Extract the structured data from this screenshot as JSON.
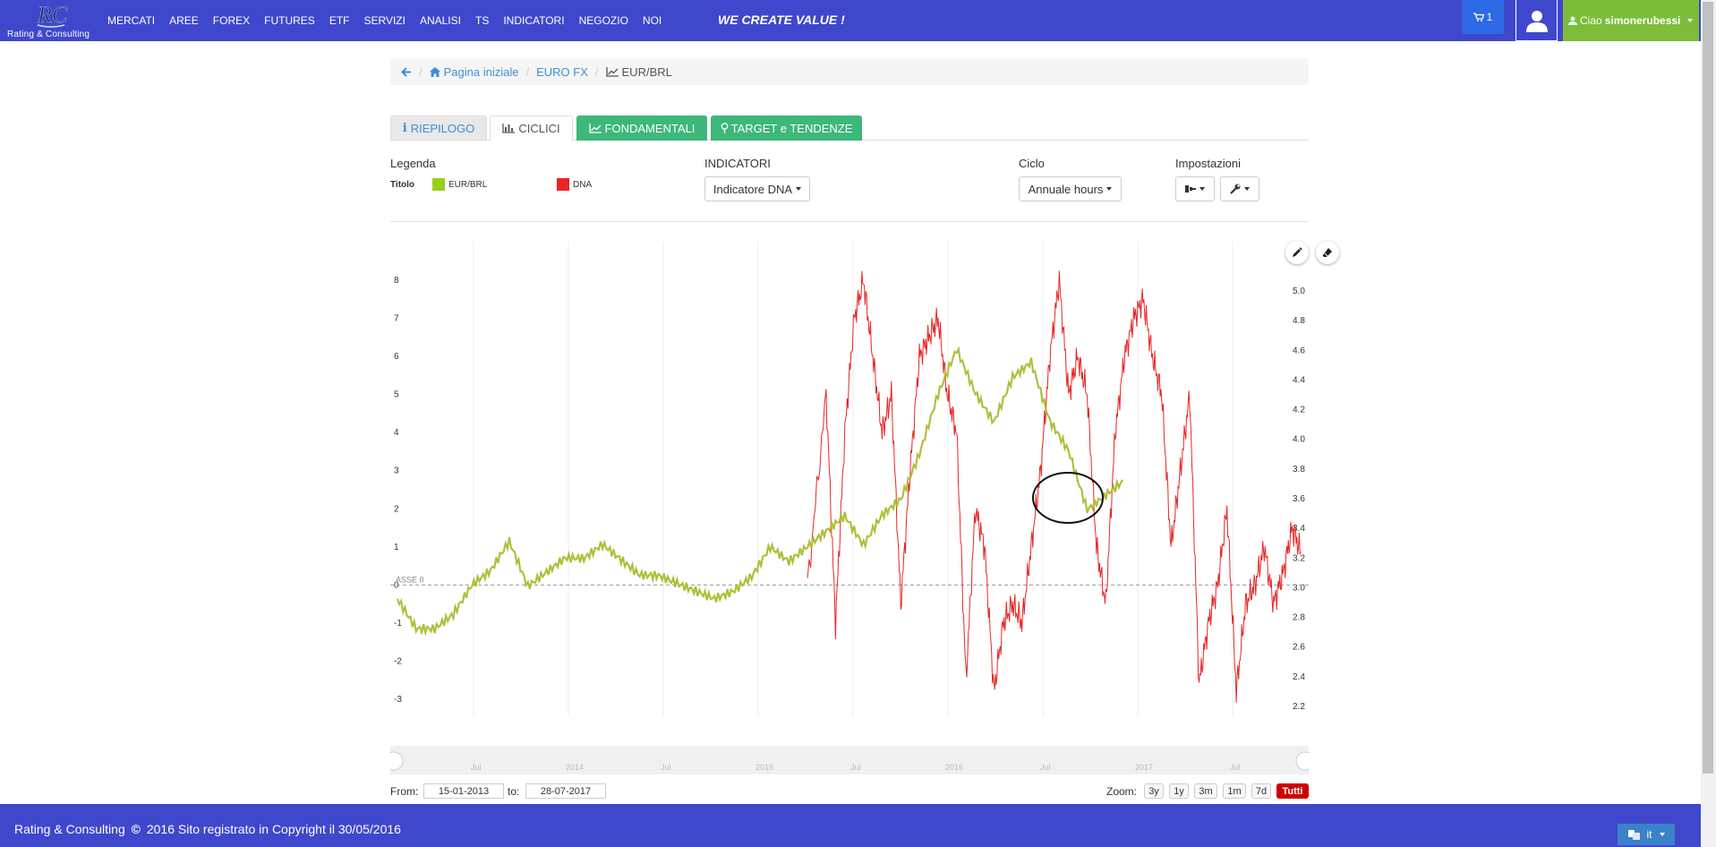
{
  "header": {
    "logo_text": "Rating & Consulting",
    "nav": [
      "MERCATI",
      "AREE",
      "FOREX",
      "FUTURES",
      "ETF",
      "SERVIZI",
      "ANALISI",
      "TS",
      "INDICATORI",
      "NEGOZIO",
      "NOI"
    ],
    "slogan": "WE CREATE VALUE !",
    "cart_count": "1",
    "greeting": "Ciao",
    "username": "simonerubessi"
  },
  "breadcrumb": {
    "home": "Pagina iniziale",
    "section": "EURO FX",
    "current": "EUR/BRL"
  },
  "tabs": [
    "RIEPILOGO",
    "CICLICI",
    "FONDAMENTALI",
    "TARGET e TENDENZE"
  ],
  "controls": {
    "legend_label": "Legenda",
    "titolo_label": "Titolo",
    "series1_name": "EUR/BRL",
    "series2_name": "DNA",
    "indicatori_label": "INDICATORI",
    "indicatore_value": "Indicatore DNA",
    "ciclo_label": "Ciclo",
    "ciclo_value": "Annuale hours",
    "impostazioni_label": "Impostazioni"
  },
  "colors": {
    "nav_bg": "#3f47cc",
    "accent_green": "#3db77a",
    "price_series": "#9acd1f",
    "dna_series": "#e82525",
    "active_zoom": "#cc0000"
  },
  "chart_data": {
    "type": "line",
    "left_axis_ticks": [
      "8",
      "7",
      "6",
      "5",
      "4",
      "3",
      "2",
      "1",
      "0",
      "-1",
      "-2",
      "-3"
    ],
    "right_axis_ticks": [
      "5.0",
      "4.8",
      "4.6",
      "4.4",
      "4.2",
      "4.0",
      "3.8",
      "3.6",
      "3.4",
      "3.2",
      "3.0",
      "2.8",
      "2.6",
      "2.4",
      "2.2"
    ],
    "zero_line_label": "ASSE 0",
    "navigator_labels": [
      "Jul",
      "2014",
      "Jul",
      "2015",
      "Jul",
      "2016",
      "Jul",
      "2017",
      "Jul"
    ],
    "left_ylim": [
      -3,
      8
    ],
    "right_ylim": [
      2.2,
      5.0
    ],
    "series": [
      {
        "name": "EUR/BRL",
        "x": [
          0,
          2,
          4,
          6,
          8,
          10,
          12,
          14,
          16,
          18,
          20,
          22,
          24,
          26,
          28,
          30,
          32,
          34,
          36,
          38,
          40,
          42,
          44,
          46,
          48,
          50,
          52,
          54,
          56,
          58,
          60,
          62,
          64,
          66,
          68,
          70,
          72,
          74,
          76,
          78
        ],
        "values": [
          2.9,
          2.7,
          2.7,
          2.8,
          3.0,
          3.1,
          3.3,
          3.0,
          3.1,
          3.2,
          3.2,
          3.3,
          3.2,
          3.1,
          3.1,
          3.05,
          3.0,
          2.95,
          3.0,
          3.1,
          3.3,
          3.2,
          3.3,
          3.4,
          3.5,
          3.3,
          3.5,
          3.6,
          3.9,
          4.3,
          4.6,
          4.3,
          4.1,
          4.4,
          4.5,
          4.1,
          3.9,
          3.5,
          3.6,
          3.7
        ]
      },
      {
        "name": "DNA",
        "x": [
          44,
          46,
          47,
          48,
          49,
          50,
          51,
          52,
          53,
          54,
          55,
          56,
          57,
          58,
          59,
          60,
          61,
          62,
          63,
          64,
          65,
          66,
          67,
          68,
          69,
          70,
          71,
          72,
          73,
          74,
          75,
          76,
          77,
          78,
          79,
          80,
          81,
          82,
          83,
          84,
          85,
          86,
          87,
          88,
          89,
          90,
          91,
          92,
          93,
          94,
          95,
          96,
          97
        ],
        "values": [
          0,
          5,
          -1,
          4,
          7,
          8,
          6,
          4,
          5,
          -0.5,
          3,
          6,
          6.5,
          7,
          5,
          4,
          -2.5,
          2,
          1,
          -2.8,
          -1,
          -0.5,
          -1,
          1,
          3,
          6,
          8,
          5,
          6,
          5,
          1,
          -0.5,
          4,
          6,
          7,
          7.5,
          6,
          5,
          1,
          3,
          5,
          -2.6,
          -1,
          0,
          2,
          -2.8,
          -0.5,
          0,
          1,
          -0.5,
          0.3,
          1.5,
          0.8
        ]
      }
    ],
    "annotation": "ellipse around 2016 EUR/BRL price consolidation"
  },
  "range": {
    "from_label": "From:",
    "from_value": "15-01-2013",
    "to_label": "to:",
    "to_value": "28-07-2017",
    "zoom_label": "Zoom:",
    "zoom_options": [
      "3y",
      "1y",
      "3m",
      "1m",
      "7d",
      "Tutti"
    ]
  },
  "footer": {
    "text": "Rating & Consulting",
    "copyright": "2016 Sito registrato in Copyright il 30/05/2016",
    "lang": "it"
  }
}
